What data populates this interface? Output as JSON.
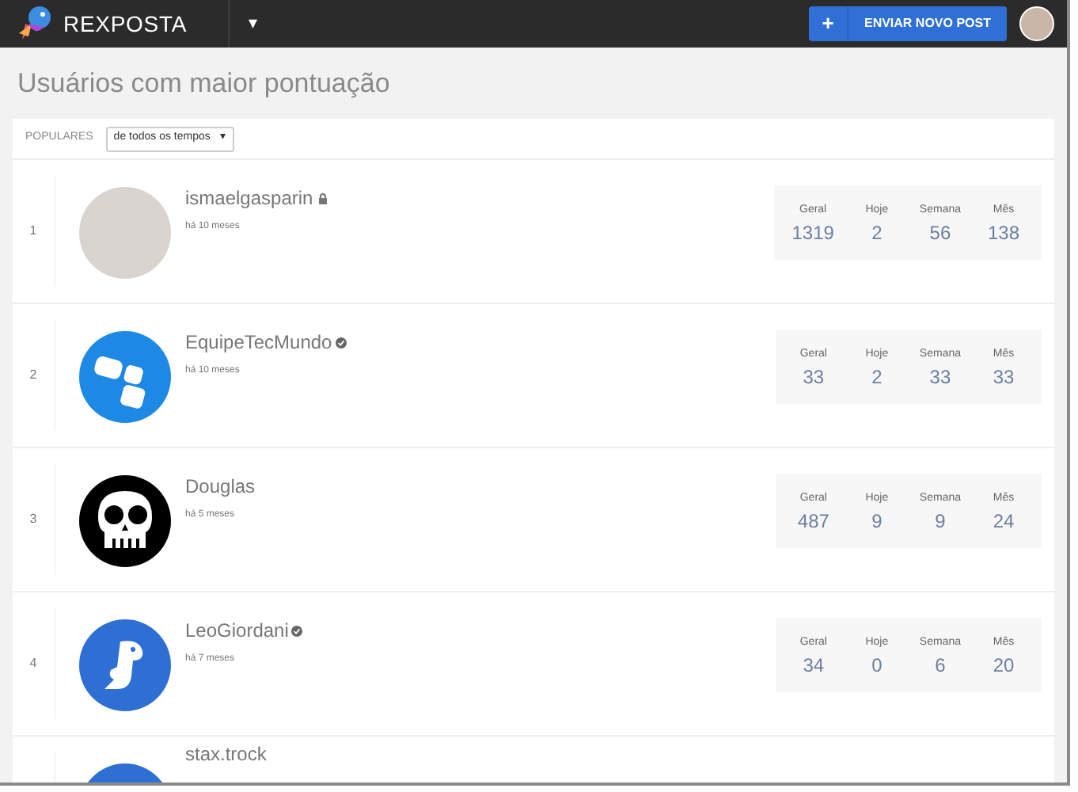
{
  "header": {
    "logo_text": "REXPOSTA",
    "dropdown_caret": "▾",
    "post_button": {
      "icon": "+",
      "label": "ENVIAR NOVO POST"
    }
  },
  "page_title": "Usuários com maior pontuação",
  "filter": {
    "label": "POPULARES",
    "select_value": "de todos os tempos",
    "select_caret": "▾"
  },
  "users": [
    {
      "rank": "1",
      "name": "ismaelgasparin",
      "badge": {
        "kind": "lock"
      },
      "avatar": {
        "kind": "photo"
      },
      "time": "há 10 meses",
      "stats": [
        {
          "label": "Geral",
          "value": "1319"
        },
        {
          "label": "Hoje",
          "value": "2"
        },
        {
          "label": "Semana",
          "value": "56"
        },
        {
          "label": "Mês",
          "value": "138"
        }
      ]
    },
    {
      "rank": "2",
      "name": "EquipeTecMundo",
      "badge": {
        "kind": "verified"
      },
      "avatar": {
        "kind": "tiles"
      },
      "time": "há 10 meses",
      "stats": [
        {
          "label": "Geral",
          "value": "33"
        },
        {
          "label": "Hoje",
          "value": "2"
        },
        {
          "label": "Semana",
          "value": "33"
        },
        {
          "label": "Mês",
          "value": "33"
        }
      ]
    },
    {
      "rank": "3",
      "name": "Douglas",
      "avatar": {
        "kind": "skull"
      },
      "time": "há 5 meses",
      "stats": [
        {
          "label": "Geral",
          "value": "487"
        },
        {
          "label": "Hoje",
          "value": "9"
        },
        {
          "label": "Semana",
          "value": "9"
        },
        {
          "label": "Mês",
          "value": "24"
        }
      ]
    },
    {
      "rank": "4",
      "name": "LeoGiordani",
      "badge": {
        "kind": "verified"
      },
      "avatar": {
        "kind": "dino"
      },
      "time": "há 7 meses",
      "stats": [
        {
          "label": "Geral",
          "value": "34"
        },
        {
          "label": "Hoje",
          "value": "0"
        },
        {
          "label": "Semana",
          "value": "6"
        },
        {
          "label": "Mês",
          "value": "20"
        }
      ]
    },
    {
      "name": "stax.trock",
      "avatar": {
        "kind": "plain"
      }
    }
  ]
}
